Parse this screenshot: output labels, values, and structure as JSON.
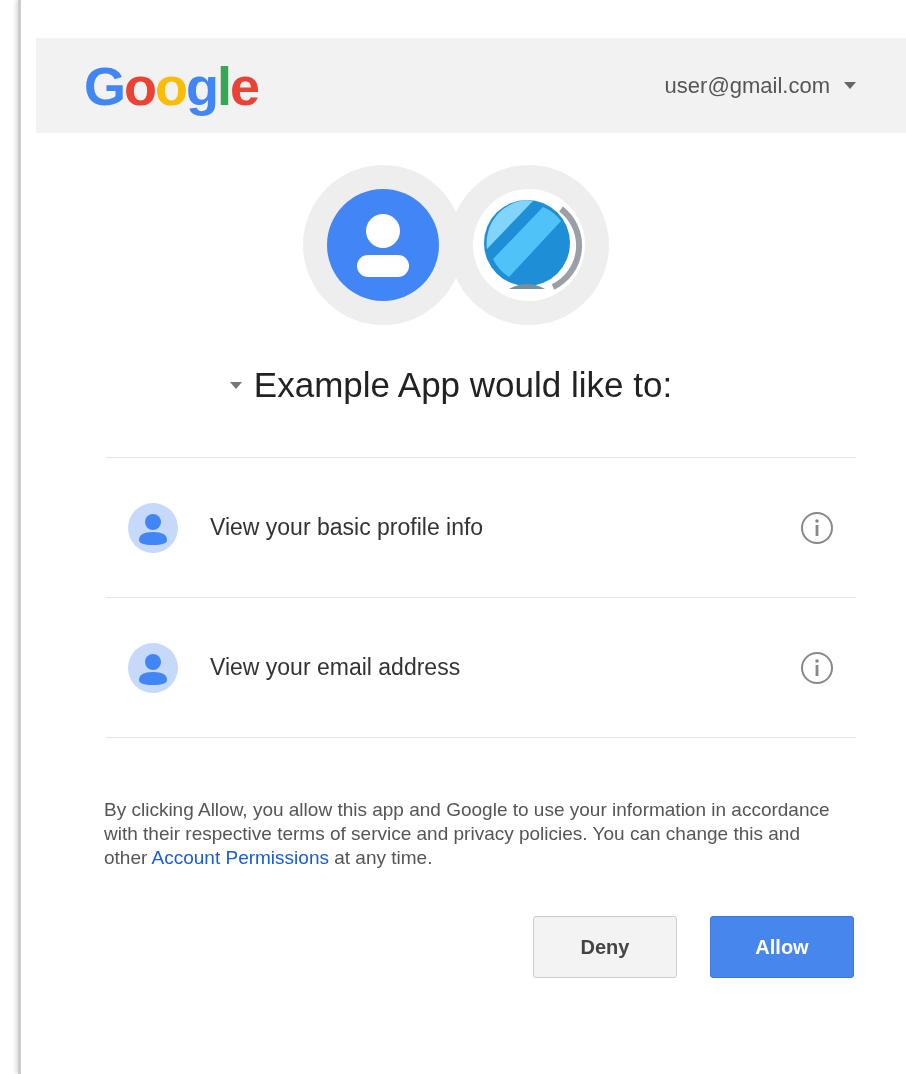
{
  "header": {
    "logo": "Google",
    "account": "user@gmail.com"
  },
  "title": "Example App would like to:",
  "permissions": [
    {
      "label": "View your basic profile info"
    },
    {
      "label": "View your email address"
    }
  ],
  "notice": {
    "before": "By clicking Allow, you allow this app and Google to use your information in accordance with their respective terms of service and privacy policies. You can change this and other ",
    "link": "Account Permissions",
    "after": " at any time."
  },
  "buttons": [
    {
      "label": "Deny",
      "kind": "secondary"
    },
    {
      "label": "Allow",
      "kind": "primary"
    }
  ]
}
